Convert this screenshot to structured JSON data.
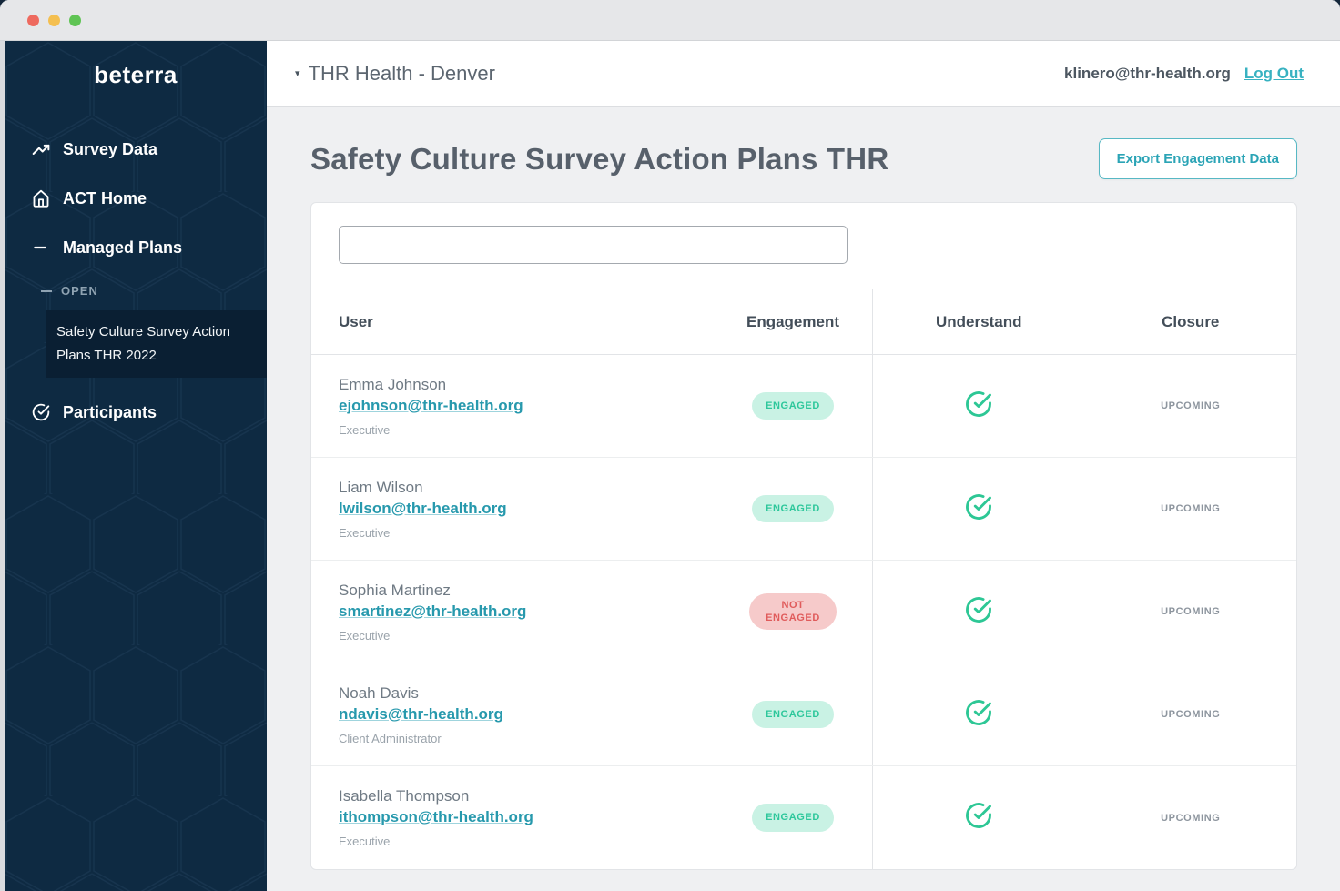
{
  "sidebar": {
    "logo": "beterra",
    "items": [
      {
        "label": "Survey Data",
        "icon": "trend-up-icon"
      },
      {
        "label": "ACT Home",
        "icon": "home-icon"
      },
      {
        "label": "Managed Plans",
        "icon": "dash-icon"
      }
    ],
    "open_section_label": "OPEN",
    "active_item": "Safety Culture Survey Action Plans THR 2022",
    "participants_label": "Participants"
  },
  "topbar": {
    "org_selector": "THR Health - Denver",
    "user_email": "klinero@thr-health.org",
    "logout_label": "Log Out"
  },
  "main": {
    "title": "Safety Culture Survey Action Plans THR",
    "export_button_label": "Export Engagement Data",
    "search": {
      "value": "",
      "placeholder": ""
    },
    "table": {
      "columns": [
        "User",
        "Engagement",
        "Understand",
        "Closure"
      ],
      "rows": [
        {
          "name": "Emma Johnson",
          "email": "ejohnson@thr-health.org",
          "role": "Executive",
          "engagement": "ENGAGED",
          "engagement_state": "engaged",
          "understand_icon": "check-circle-icon",
          "closure": "UPCOMING"
        },
        {
          "name": "Liam Wilson",
          "email": "lwilson@thr-health.org",
          "role": "Executive",
          "engagement": "ENGAGED",
          "engagement_state": "engaged",
          "understand_icon": "check-circle-icon",
          "closure": "UPCOMING"
        },
        {
          "name": "Sophia Martinez",
          "email": "smartinez@thr-health.org",
          "role": "Executive",
          "engagement": "NOT ENGAGED",
          "engagement_state": "not-engaged",
          "understand_icon": "check-circle-icon",
          "closure": "UPCOMING"
        },
        {
          "name": "Noah Davis",
          "email": "ndavis@thr-health.org",
          "role": "Client Administrator",
          "engagement": "ENGAGED",
          "engagement_state": "engaged",
          "understand_icon": "check-circle-icon",
          "closure": "UPCOMING"
        },
        {
          "name": "Isabella Thompson",
          "email": "ithompson@thr-health.org",
          "role": "Executive",
          "engagement": "ENGAGED",
          "engagement_state": "engaged",
          "understand_icon": "check-circle-icon",
          "closure": "UPCOMING"
        }
      ]
    }
  },
  "colors": {
    "sidebar_bg": "#0e2a42",
    "sidebar_active_bg": "#0a1f33",
    "accent_teal": "#2ba4b6",
    "link_teal": "#2799ad",
    "engaged_bg": "#c9f2e4",
    "engaged_text": "#2dc79b",
    "not_engaged_bg": "#f6caca",
    "not_engaged_text": "#e05b5b",
    "check_green": "#2dc795"
  }
}
